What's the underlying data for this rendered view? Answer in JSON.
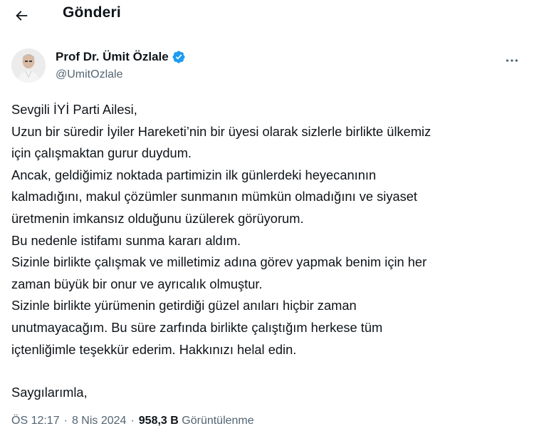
{
  "header": {
    "title": "Gönderi"
  },
  "author": {
    "display_name": "Prof Dr. Ümit Özlale",
    "handle": "@UmitOzlale",
    "verified_color": "#1d9bf0"
  },
  "tweet": {
    "lines": [
      "Sevgili İYİ Parti Ailesi,",
      "Uzun bir süredir İyiler Hareketi’nin bir üyesi olarak sizlerle birlikte ülkemiz",
      "için çalışmaktan gurur duydum.",
      "Ancak, geldiğimiz noktada partimizin ilk günlerdeki heyecanının",
      "kalmadığını, makul çözümler sunmanın mümkün olmadığını ve siyaset",
      "üretmenin imkansız olduğunu üzülerek görüyorum.",
      "Bu nedenle istifamı sunma kararı aldım.",
      "Sizinle birlikte çalışmak ve milletimiz adına görev yapmak benim için her",
      "zaman büyük bir onur ve ayrıcalık olmuştur.",
      "Sizinle birlikte yürümenin getirdiği güzel anıları hiçbir zaman",
      "unutmayacağım. Bu süre zarfında birlikte çalıştığım herkese tüm",
      "içtenliğimle teşekkür ederim. Hakkınızı helal edin."
    ],
    "closing": "Saygılarımla,"
  },
  "meta": {
    "time": "ÖS 12:17",
    "date": "8 Nis 2024",
    "views_count": "958,3 B",
    "views_label": "Görüntülenme"
  },
  "icons": {
    "back": "arrow-left-icon",
    "more": "more-horizontal-icon",
    "verified": "verified-badge-icon"
  }
}
